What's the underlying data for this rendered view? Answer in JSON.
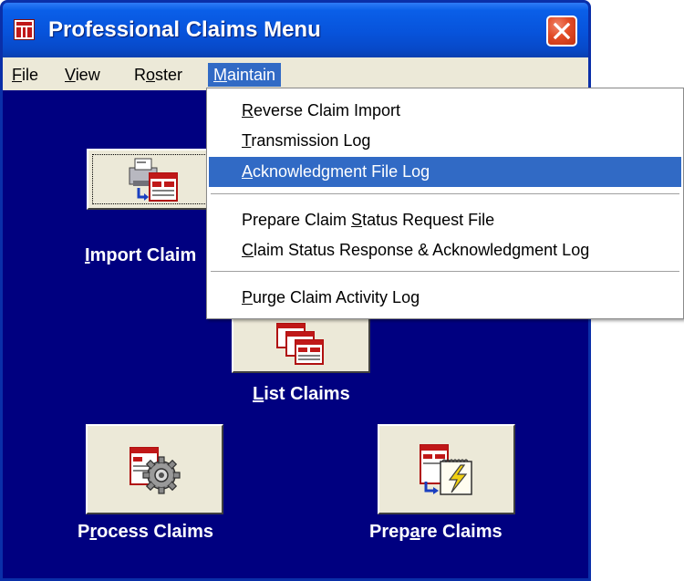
{
  "window": {
    "title": "Professional Claims Menu",
    "accent": "#0831D9",
    "client_bg": "#000080"
  },
  "menubar": [
    {
      "pre": "",
      "key": "F",
      "post": "ile"
    },
    {
      "pre": "",
      "key": "V",
      "post": "iew"
    },
    {
      "pre": "R",
      "key": "o",
      "post": "ster"
    },
    {
      "pre": "",
      "key": "M",
      "post": "aintain"
    }
  ],
  "maintain_menu": [
    {
      "pre": "",
      "key": "R",
      "post": "everse Claim Import"
    },
    {
      "pre": "",
      "key": "T",
      "post": "ransmission Log"
    },
    {
      "pre": "",
      "key": "A",
      "post": "cknowledgment File Log"
    },
    {
      "pre": "Prepare Claim ",
      "key": "S",
      "post": "tatus Request File"
    },
    {
      "pre": "",
      "key": "C",
      "post": "laim Status Response & Acknowledgment Log"
    },
    {
      "pre": "",
      "key": "P",
      "post": "urge Claim Activity Log"
    }
  ],
  "buttons": {
    "import": {
      "pre": "",
      "key": "I",
      "post": "mport Claim",
      "icon": "printer-import-icon"
    },
    "list": {
      "pre": "",
      "key": "L",
      "post": "ist Claims",
      "icon": "stacked-forms-icon"
    },
    "process": {
      "pre": "P",
      "key": "r",
      "post": "ocess Claims",
      "icon": "gear-form-icon"
    },
    "prepare": {
      "pre": "Prep",
      "key": "a",
      "post": "re Claims",
      "icon": "form-lightning-icon"
    }
  }
}
